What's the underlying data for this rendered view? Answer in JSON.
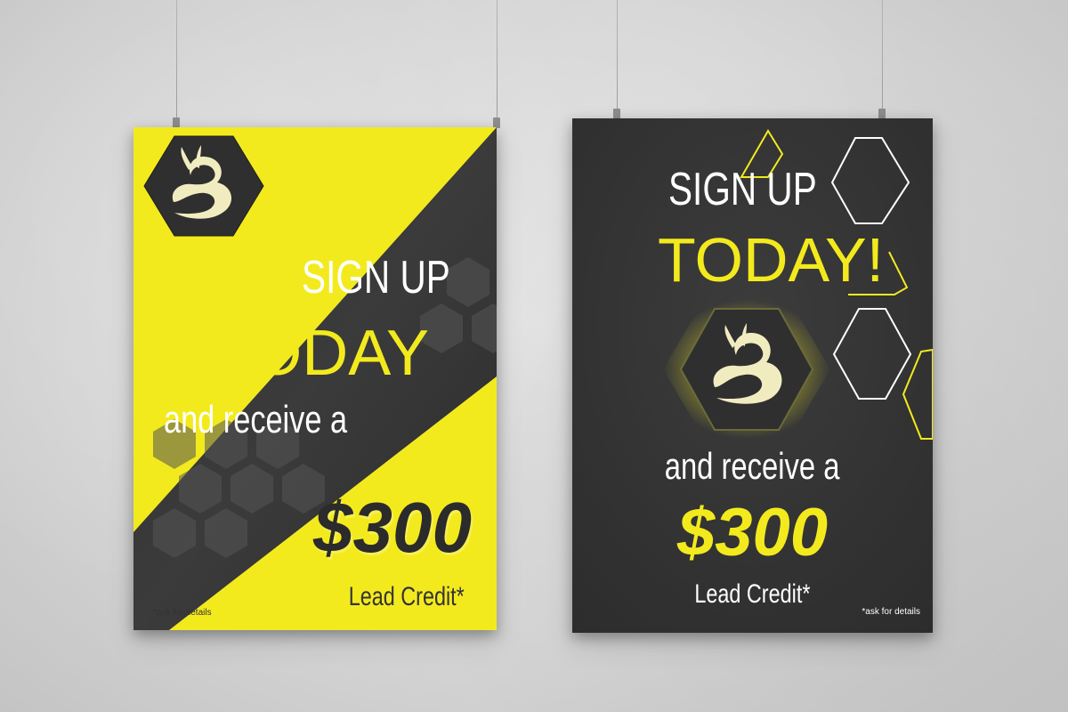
{
  "colors": {
    "accent": "#f3ea1e",
    "dark": "#333333",
    "white": "#ffffff",
    "logo_fill": "#f1ecc0"
  },
  "icons": {
    "logo": "snail-b-logo-icon",
    "hexagons": "hexagon-pattern-icon"
  },
  "poster_left": {
    "headline_line1": "SIGN UP",
    "headline_line2": "TODAY",
    "subline": "and receive a",
    "amount": "$300",
    "credit": "Lead Credit*",
    "disclaimer": "*ask for details"
  },
  "poster_right": {
    "headline_line1": "SIGN UP",
    "headline_line2": "TODAY!",
    "subline": "and receive a",
    "amount": "$300",
    "credit": "Lead Credit*",
    "disclaimer": "*ask for details"
  }
}
